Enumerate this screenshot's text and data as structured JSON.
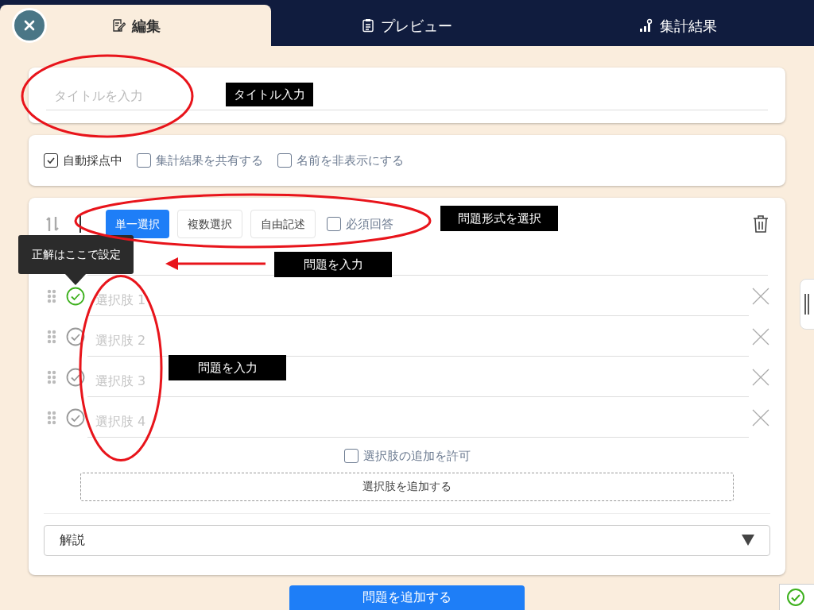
{
  "tabs": [
    {
      "label": "編集",
      "selected": true
    },
    {
      "label": "プレビュー",
      "selected": false
    },
    {
      "label": "集計結果",
      "selected": false
    }
  ],
  "title_field": {
    "placeholder": "タイトルを入力"
  },
  "options": [
    {
      "label": "自動採点中",
      "checked": true
    },
    {
      "label": "集計結果を共有する",
      "checked": false
    },
    {
      "label": "名前を非表示にする",
      "checked": false
    }
  ],
  "question": {
    "types": [
      {
        "label": "単一選択",
        "selected": true
      },
      {
        "label": "複数選択",
        "selected": false
      },
      {
        "label": "自由記述",
        "selected": false
      }
    ],
    "required": {
      "label": "必須回答",
      "checked": false
    },
    "tooltip": "正解はここで設定",
    "choices": [
      {
        "placeholder": "選択肢 1",
        "correct": true
      },
      {
        "placeholder": "選択肢 2",
        "correct": false
      },
      {
        "placeholder": "選択肢 3",
        "correct": false
      },
      {
        "placeholder": "選択肢 4",
        "correct": false
      }
    ],
    "allow_add": {
      "label": "選択肢の追加を許可",
      "checked": false
    },
    "add_choice_button": "選択肢を追加する",
    "explanation": "解説"
  },
  "add_question_button": "問題を追加する",
  "annotations": [
    "タイトル入力",
    "問題形式を選択",
    "問題を入力",
    "問題を入力"
  ]
}
